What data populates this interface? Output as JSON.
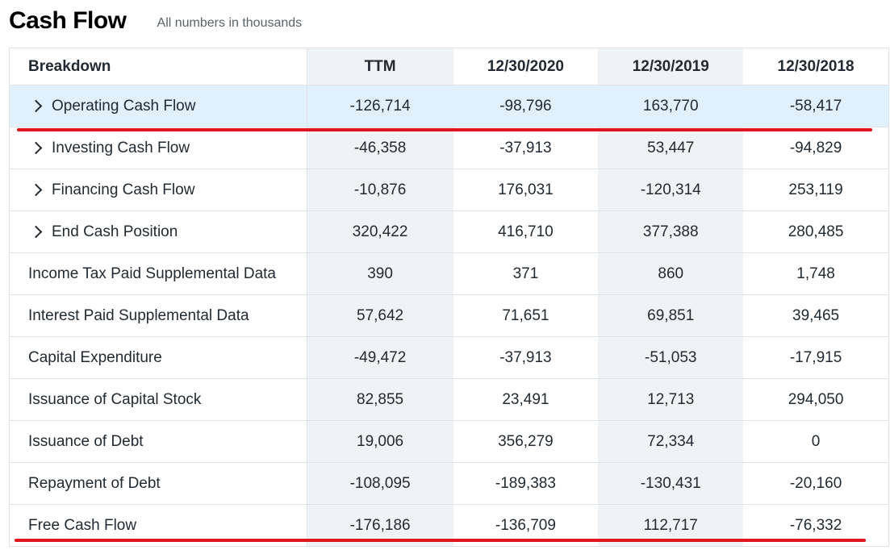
{
  "header": {
    "title": "Cash Flow",
    "subtitle": "All numbers in thousands"
  },
  "table": {
    "columns": [
      "Breakdown",
      "TTM",
      "12/30/2020",
      "12/30/2019",
      "12/30/2018"
    ],
    "rows": [
      {
        "label": "Operating Cash Flow",
        "expandable": true,
        "values": [
          "-126,714",
          "-98,796",
          "163,770",
          "-58,417"
        ]
      },
      {
        "label": "Investing Cash Flow",
        "expandable": true,
        "values": [
          "-46,358",
          "-37,913",
          "53,447",
          "-94,829"
        ]
      },
      {
        "label": "Financing Cash Flow",
        "expandable": true,
        "values": [
          "-10,876",
          "176,031",
          "-120,314",
          "253,119"
        ]
      },
      {
        "label": "End Cash Position",
        "expandable": true,
        "values": [
          "320,422",
          "416,710",
          "377,388",
          "280,485"
        ]
      },
      {
        "label": "Income Tax Paid Supplemental Data",
        "expandable": false,
        "values": [
          "390",
          "371",
          "860",
          "1,748"
        ]
      },
      {
        "label": "Interest Paid Supplemental Data",
        "expandable": false,
        "values": [
          "57,642",
          "71,651",
          "69,851",
          "39,465"
        ]
      },
      {
        "label": "Capital Expenditure",
        "expandable": false,
        "values": [
          "-49,472",
          "-37,913",
          "-51,053",
          "-17,915"
        ]
      },
      {
        "label": "Issuance of Capital Stock",
        "expandable": false,
        "values": [
          "82,855",
          "23,491",
          "12,713",
          "294,050"
        ]
      },
      {
        "label": "Issuance of Debt",
        "expandable": false,
        "values": [
          "19,006",
          "356,279",
          "72,334",
          "0"
        ]
      },
      {
        "label": "Repayment of Debt",
        "expandable": false,
        "values": [
          "-108,095",
          "-189,383",
          "-130,431",
          "-20,160"
        ]
      },
      {
        "label": "Free Cash Flow",
        "expandable": false,
        "values": [
          "-176,186",
          "-136,709",
          "112,717",
          "-76,332"
        ]
      }
    ]
  },
  "colors": {
    "highlight_row": "#e0f0fd",
    "shaded_column": "#f0f3f5",
    "annotation_line": "#e0161e"
  }
}
